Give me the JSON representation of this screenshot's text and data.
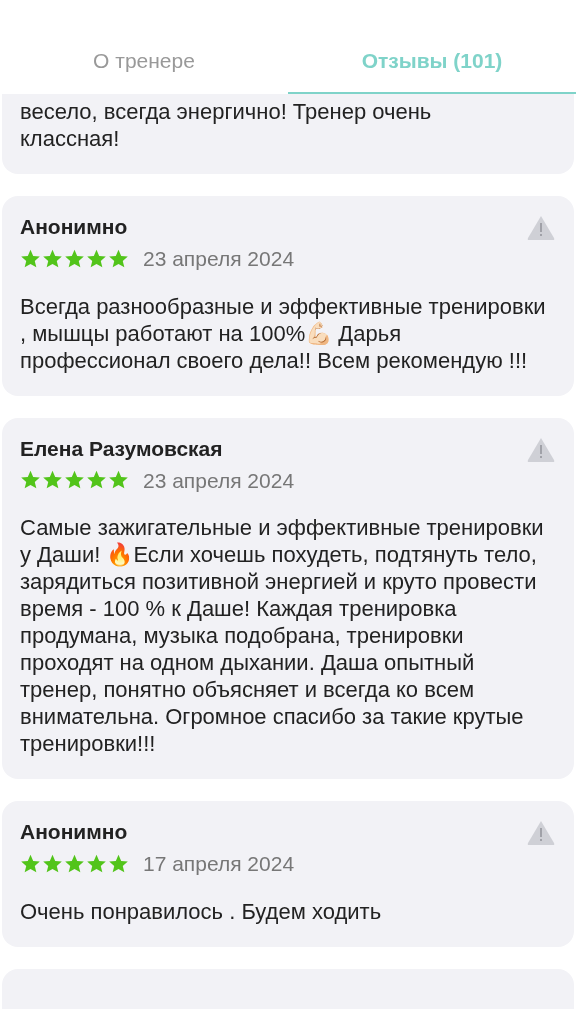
{
  "tabs": [
    {
      "label": "О тренере",
      "selected": false
    },
    {
      "label": "Отзывы (101)",
      "selected": true
    }
  ],
  "reviews": [
    {
      "text": "весело, всегда энергично! Тренер очень классная!"
    },
    {
      "author": "Анонимно",
      "stars": 5,
      "date": "23 апреля 2024",
      "text": "Всегда разнообразные и эффективные тренировки , мышцы работают на 100%💪🏻 Дарья профессионал своего дела!! Всем рекомендую !!!"
    },
    {
      "author": "Елена Разумовская",
      "stars": 5,
      "date": "23 апреля 2024",
      "text": "Самые зажигательные и эффективные тренировки у Даши! 🔥Если хочешь похудеть, подтянуть тело, зарядиться позитивной энергией и круто провести время - 100 % к Даше! Каждая тренировка продумана, музыка подобрана, тренировки проходят на одном дыхании. Даша опытный тренер, понятно объясняет и всегда ко всем внимательна. Огромное спасибо за такие крутые тренировки!!!"
    },
    {
      "author": "Анонимно",
      "stars": 5,
      "date": "17 апреля 2024",
      "text": "Очень понравилось . Будем ходить"
    }
  ]
}
